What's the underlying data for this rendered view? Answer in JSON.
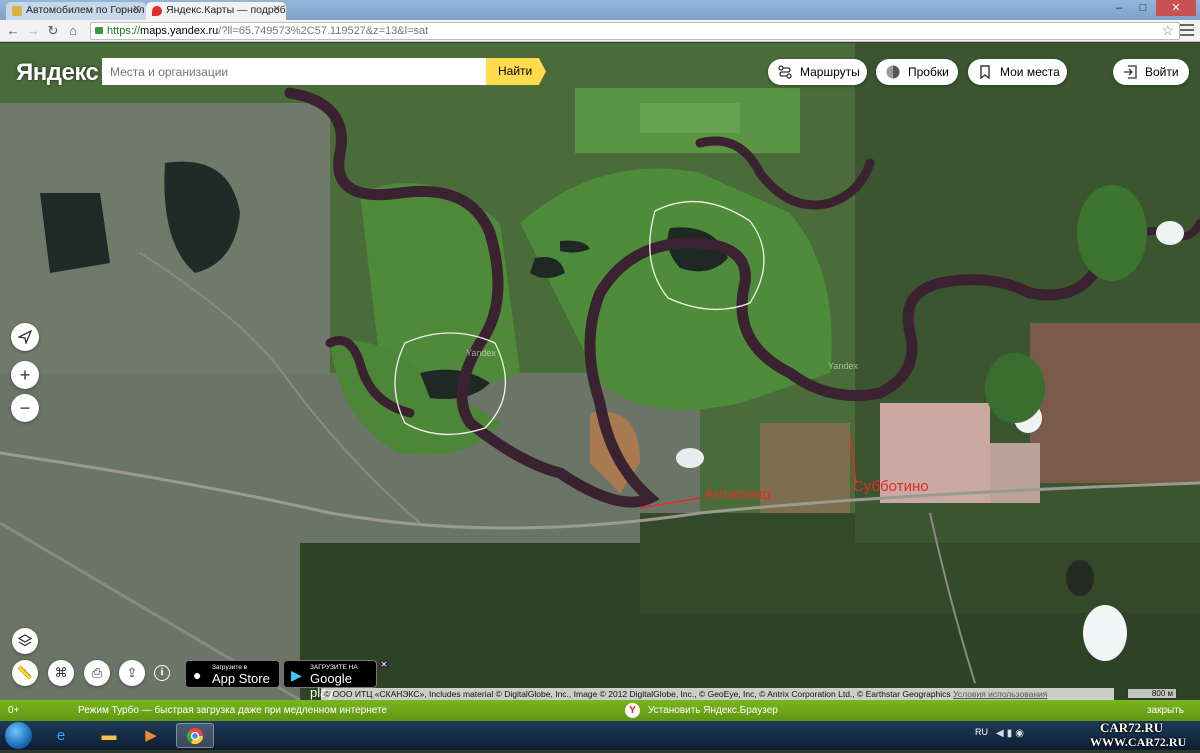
{
  "browser": {
    "tabs": [
      {
        "title": "Автомобилем по Горнол",
        "favicon": "forum-favicon",
        "color": "#d9b042"
      },
      {
        "title": "Яндекс.Карты — подроб",
        "favicon": "map-pin-favicon",
        "color": "#e52a2a"
      }
    ],
    "address": {
      "scheme": "https://",
      "host": "maps.yandex.ru",
      "path": "/?ll=65.749573%2C57.119527&z=13&l=sat"
    }
  },
  "map": {
    "logo": "Яндекс",
    "search": {
      "placeholder": "Места и организации",
      "button": "Найти"
    },
    "header_buttons": {
      "routes": "Маршруты",
      "traffic": "Пробки",
      "my_places": "Мои места",
      "login": "Войти"
    },
    "controls": {
      "zoom_in": "+",
      "zoom_out": "−"
    },
    "stores": {
      "apple_small": "Загрузите в",
      "apple_big": "App Store",
      "google_small": "ЗАГРУЗИТЕ НА",
      "google_big": "Google play"
    },
    "attribution": "© ООО ИТЦ «СКАНЭКС», Includes material © DigitalGlobe, Inc., Image © 2012 DigitalGlobe, Inc., © GeoEye, Inc, © Antrix Corporation Ltd., © Earthstar Geographics",
    "terms": "Условия использования",
    "scale": "800 м",
    "annotations": [
      "Антипино",
      "Субботино"
    ],
    "watermarks": [
      "Yandex",
      "Yandex"
    ]
  },
  "promo": {
    "age": "0+",
    "turbo_text": "Режим Турбо — быстрая загрузка даже при медленном интернете",
    "install_text": "Установить Яндекс.Браузер",
    "close": "закрыть"
  },
  "taskbar": {
    "language": "RU",
    "watermark_top": "CAR72.RU",
    "watermark_bottom": "WWW.CAR72.RU"
  },
  "colors": {
    "accent_yellow": "#ffdb4d",
    "promo_green": "#6aa318",
    "annotation_red": "#e52a2a"
  }
}
